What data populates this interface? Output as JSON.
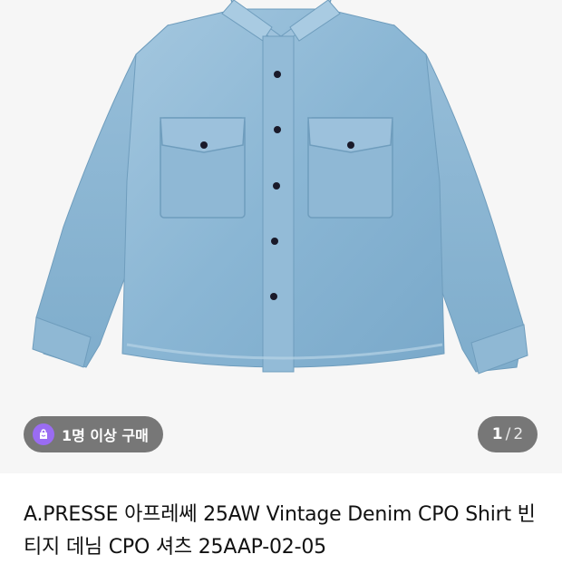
{
  "gallery": {
    "image_alt": "Vintage denim CPO shirt",
    "buyer_badge": {
      "icon": "bag-icon",
      "label": "1명 이상 구매",
      "icon_color": "#9a6cf2"
    },
    "page_indicator": {
      "current": "1",
      "separator": "/",
      "total": "2"
    }
  },
  "product": {
    "title": "A.PRESSE 아프레쎄 25AW Vintage Denim CPO Shirt 빈티지 데님 CPO 셔츠 25AAP-02-05"
  },
  "colors": {
    "denim": "#8cb8d6",
    "background": "#f6f6f6",
    "badge_bg": "#5a5a5a"
  }
}
